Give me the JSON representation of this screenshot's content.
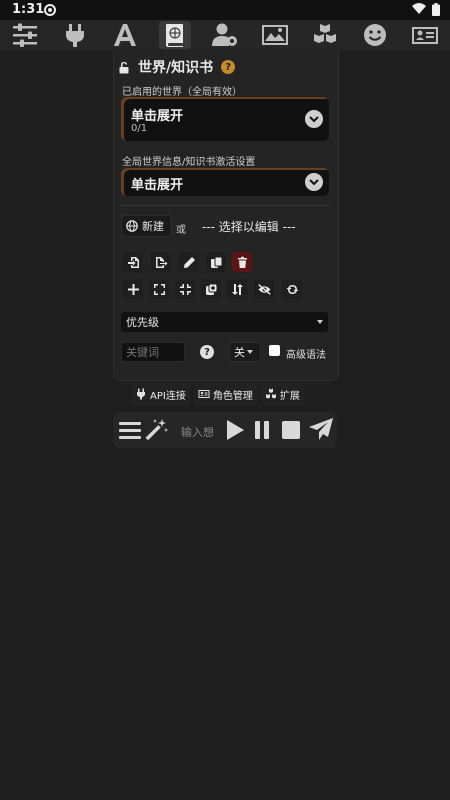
{
  "status": {
    "time": "1:31"
  },
  "topbar": {
    "icons": [
      "sliders-icon",
      "plug-icon",
      "font-icon",
      "book-atlas-icon",
      "user-gear-icon",
      "landscape-icon",
      "cubes-icon",
      "smile-icon",
      "id-card-icon"
    ],
    "active_index": 3
  },
  "panel": {
    "title": "世界/知识书",
    "help": "?",
    "active_worlds_label": "已启用的世界（全局有效）",
    "active_worlds_drawer": {
      "title": "单击展开",
      "count": "0/1"
    },
    "global_settings_label": "全局世界信息/知识书激活设置",
    "global_settings_drawer": {
      "title": "单击展开"
    },
    "new_button": "新建",
    "or_text": "或",
    "select_placeholder": "--- 选择以编辑 ---",
    "sort_select": "优先级",
    "keyword_placeholder": "关键词",
    "help2": "?",
    "toggle_value": "关",
    "advanced_syntax": "高级语法"
  },
  "bottombar": {
    "api": "API连接",
    "characters": "角色管理",
    "extensions": "扩展"
  },
  "composer": {
    "placeholder": "输入想"
  },
  "colors": {
    "background": "#1e1e1e",
    "panel": "#242424",
    "accent": "#c48a2c",
    "danger": "#5a1616"
  }
}
